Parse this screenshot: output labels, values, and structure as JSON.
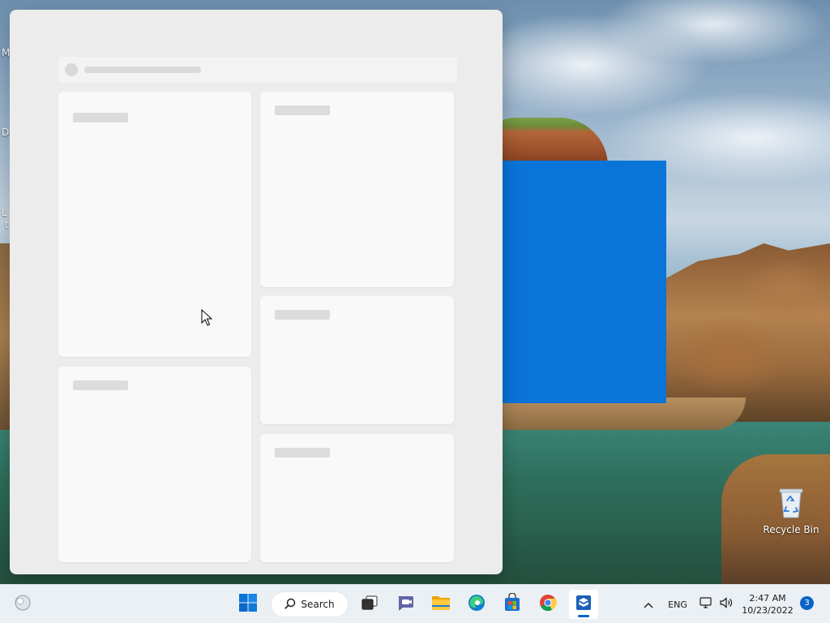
{
  "desktop": {
    "edge_labels": [
      "M",
      "D",
      "L",
      "t"
    ],
    "recycle_bin": {
      "label": "Recycle Bin",
      "icon": "recycle-bin-icon"
    },
    "accent_square_color": "#0a74d8"
  },
  "widgets_panel": {
    "state": "loading",
    "search_placeholder": "",
    "cards": [
      {
        "id": "card-1",
        "title": ""
      },
      {
        "id": "card-2",
        "title": ""
      },
      {
        "id": "card-3",
        "title": ""
      },
      {
        "id": "card-4",
        "title": ""
      },
      {
        "id": "card-5",
        "title": ""
      }
    ]
  },
  "taskbar": {
    "widgets_icon": "weather-widgets-icon",
    "start_icon": "windows-start-icon",
    "search_label": "Search",
    "pinned": [
      {
        "name": "task-view",
        "icon": "task-view-icon"
      },
      {
        "name": "chat",
        "icon": "teams-chat-icon"
      },
      {
        "name": "file-explorer",
        "icon": "folder-icon"
      },
      {
        "name": "edge",
        "icon": "edge-icon"
      },
      {
        "name": "store",
        "icon": "store-icon"
      },
      {
        "name": "chrome",
        "icon": "chrome-icon"
      },
      {
        "name": "sandbox",
        "icon": "sandbox-icon",
        "active": true
      }
    ],
    "tray": {
      "chevron_icon": "chevron-up-icon",
      "language": "ENG",
      "network_icon": "network-icon",
      "volume_icon": "volume-icon",
      "time": "2:47 AM",
      "date": "10/23/2022",
      "notification_count": "3"
    },
    "accent_color": "#0a64c8"
  }
}
